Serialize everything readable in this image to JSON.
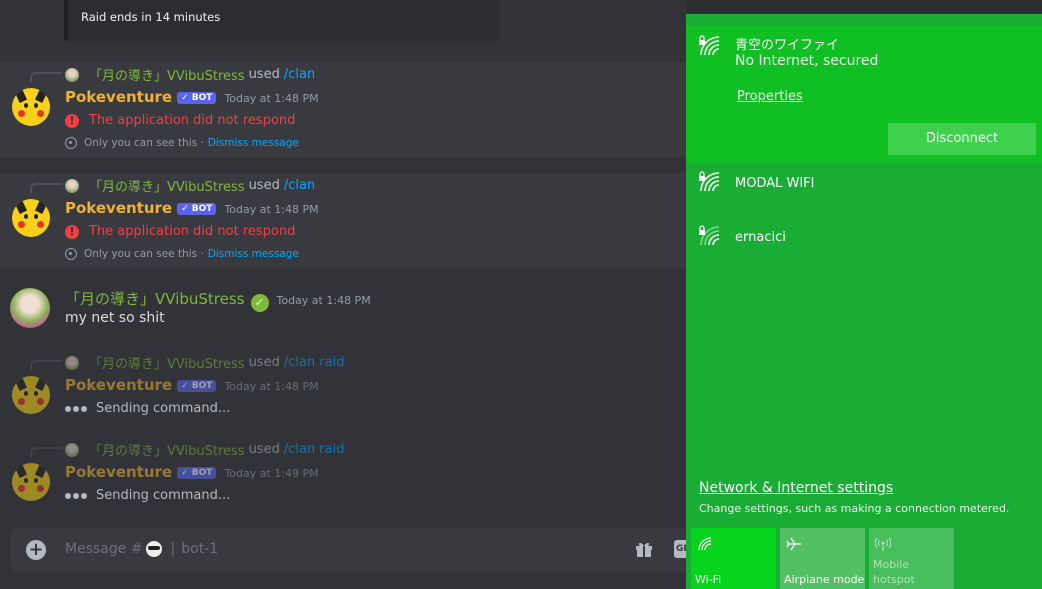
{
  "raid": {
    "text": "Raid ends in 14 minutes"
  },
  "messages": [
    {
      "reply_user": "「月の導き」VVibuStress",
      "reply_used": "used",
      "reply_cmd": "/clan",
      "author": "Pokeventure",
      "bot_tag": "✓ BOT",
      "time": "Today at 1:48 PM",
      "error": "The application did not respond",
      "ephemeral": "Only you can see this ·",
      "dismiss": "Dismiss message"
    },
    {
      "reply_user": "「月の導き」VVibuStress",
      "reply_used": "used",
      "reply_cmd": "/clan",
      "author": "Pokeventure",
      "bot_tag": "✓ BOT",
      "time": "Today at 1:48 PM",
      "error": "The application did not respond",
      "ephemeral": "Only you can see this ·",
      "dismiss": "Dismiss message"
    },
    {
      "author": "「月の導き」VVibuStress",
      "badge": "✓",
      "time": "Today at 1:48 PM",
      "text": "my net so shit"
    },
    {
      "reply_user": "「月の導き」VVibuStress",
      "reply_used": "used",
      "reply_cmd": "/clan raid",
      "author": "Pokeventure",
      "bot_tag": "✓ BOT",
      "time": "Today at 1:48 PM",
      "status": "Sending command..."
    },
    {
      "reply_user": "「月の導き」VVibuStress",
      "reply_used": "used",
      "reply_cmd": "/clan raid",
      "author": "Pokeventure",
      "bot_tag": "✓ BOT",
      "time": "Today at 1:49 PM",
      "status": "Sending command..."
    }
  ],
  "composer": {
    "placeholder_prefix": "Message #",
    "placeholder_sep": "|",
    "channel": "bot-1",
    "gif_label": "GI"
  },
  "network": {
    "active": {
      "name": "青空のワイファイ",
      "status": "No Internet, secured",
      "properties": "Properties",
      "disconnect": "Disconnect"
    },
    "others": [
      {
        "name": "MODAL WIFI"
      },
      {
        "name": "ernacici"
      }
    ],
    "settings_link": "Network & Internet settings",
    "settings_sub": "Change settings, such as making a connection metered.",
    "quick_actions": [
      {
        "label": "Wi-Fi",
        "icon": "wifi-icon",
        "active": true
      },
      {
        "label": "Airplane mode",
        "icon": "airplane-icon",
        "active": false
      },
      {
        "label": "Mobile hotspot",
        "icon": "hotspot-icon",
        "active": false
      }
    ]
  },
  "colors": {
    "chat_bg": "#313338",
    "bot_name": "#f0b232",
    "error": "#f23f43",
    "link": "#00a8fc",
    "flyout_bg": "#1aad35",
    "flyout_active": "#10c022"
  }
}
